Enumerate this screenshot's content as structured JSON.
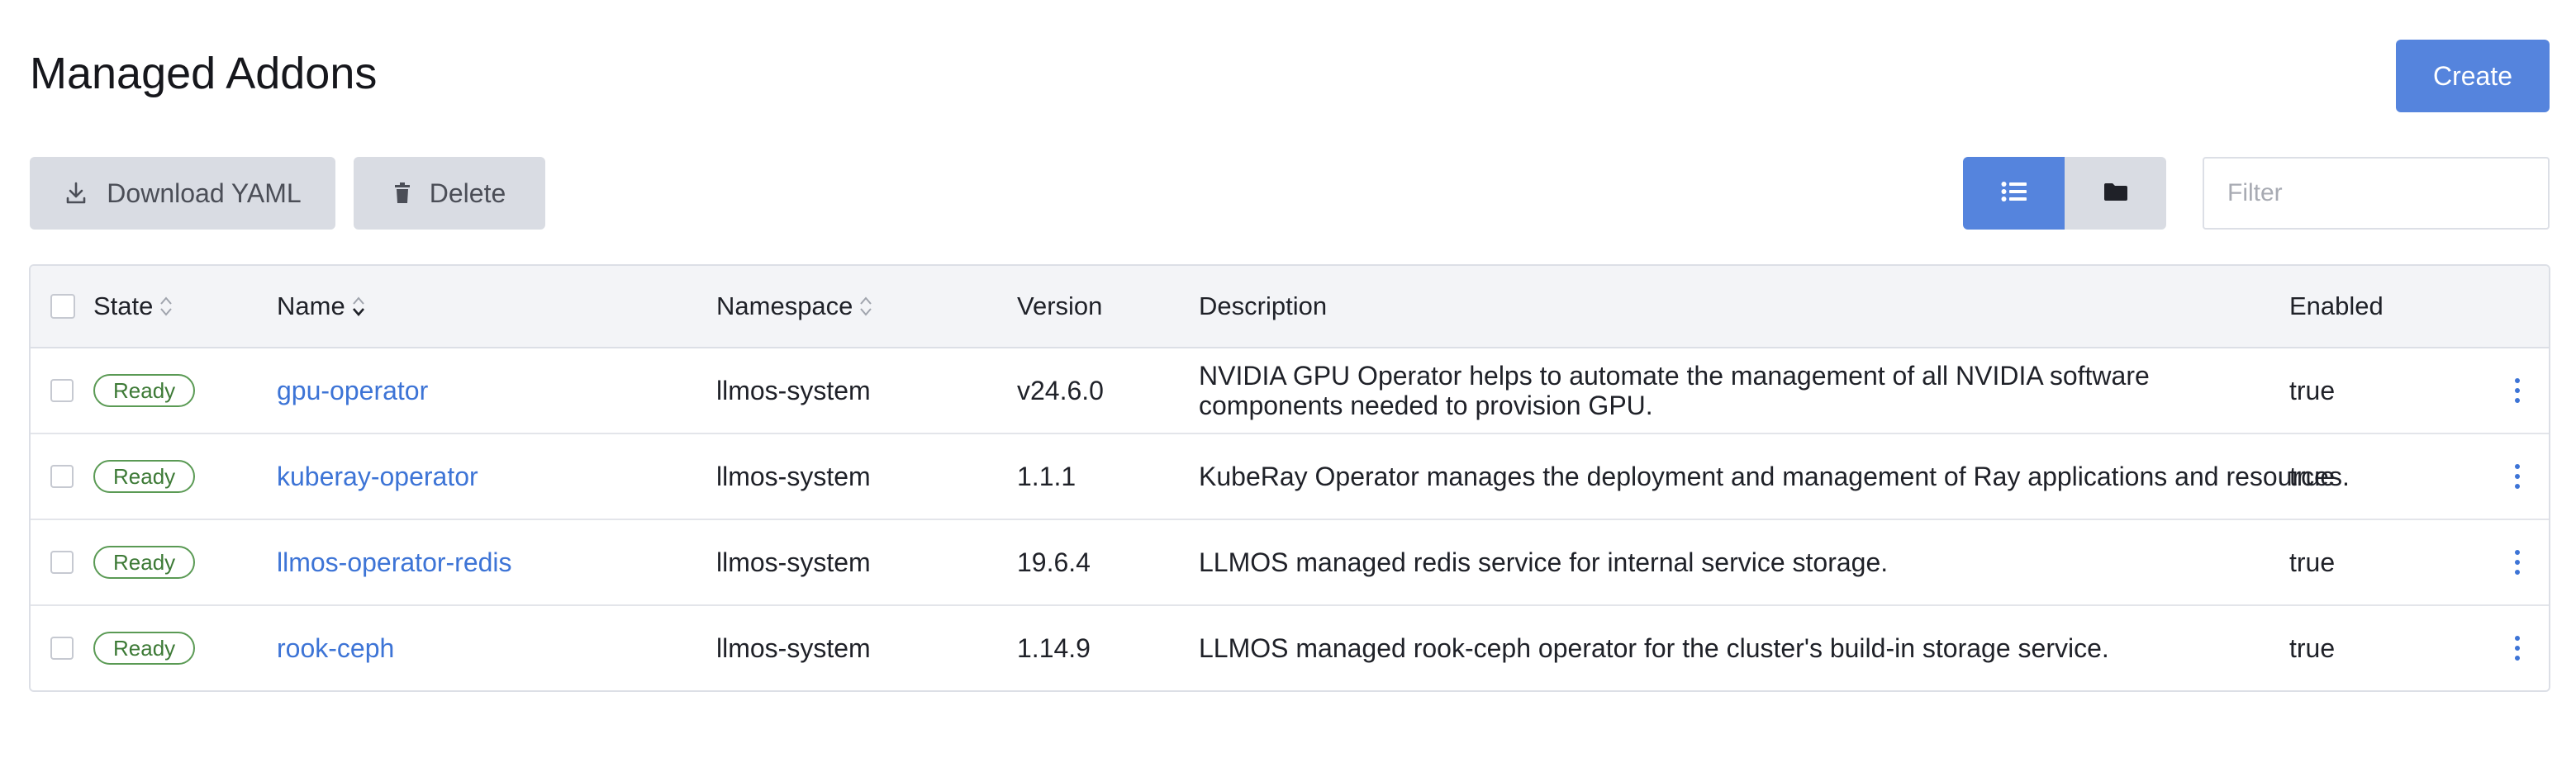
{
  "page": {
    "title": "Managed Addons",
    "create_label": "Create"
  },
  "toolbar": {
    "download_label": "Download YAML",
    "delete_label": "Delete",
    "filter_placeholder": "Filter"
  },
  "colors": {
    "accent": "#5584dd",
    "link": "#3d74d6",
    "ready": "#3d7a36",
    "button_gray": "#d9dce3"
  },
  "table": {
    "headers": {
      "state": "State",
      "name": "Name",
      "namespace": "Namespace",
      "version": "Version",
      "description": "Description",
      "enabled": "Enabled"
    },
    "rows": [
      {
        "state": "Ready",
        "name": "gpu-operator",
        "namespace": "llmos-system",
        "version": "v24.6.0",
        "description": "NVIDIA GPU Operator helps to automate the management of all NVIDIA software components needed to provision GPU.",
        "enabled": "true"
      },
      {
        "state": "Ready",
        "name": "kuberay-operator",
        "namespace": "llmos-system",
        "version": "1.1.1",
        "description": "KubeRay Operator manages the deployment and management of Ray applications and resources.",
        "enabled": "true"
      },
      {
        "state": "Ready",
        "name": "llmos-operator-redis",
        "namespace": "llmos-system",
        "version": "19.6.4",
        "description": "LLMOS managed redis service for internal service storage.",
        "enabled": "true"
      },
      {
        "state": "Ready",
        "name": "rook-ceph",
        "namespace": "llmos-system",
        "version": "1.14.9",
        "description": "LLMOS managed rook-ceph operator for the cluster's build-in storage service.",
        "enabled": "true"
      }
    ]
  }
}
